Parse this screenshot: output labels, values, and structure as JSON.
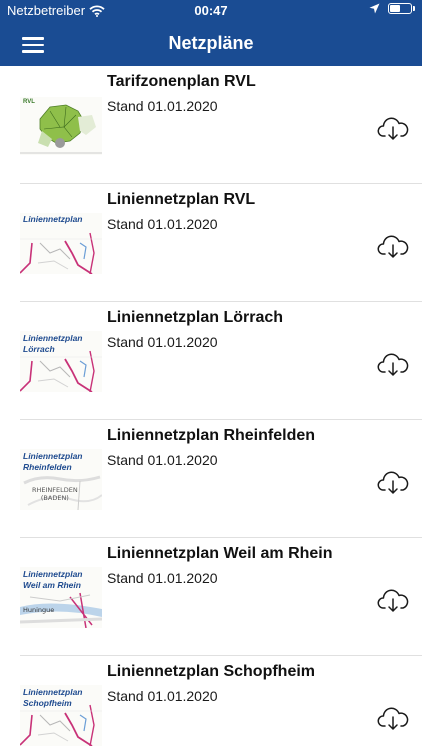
{
  "status_bar": {
    "carrier": "Netzbetreiber",
    "time": "00:47",
    "battery_level": 0.55
  },
  "nav": {
    "title": "Netzpläne",
    "menu_icon": "hamburger-menu-icon"
  },
  "theme": {
    "header_color": "#1a4c93",
    "link_color": "#1f4b8f"
  },
  "plans": [
    {
      "title": "Tarifzonenplan RVL",
      "date": "Stand 01.01.2020",
      "thumb_label": "RVL",
      "thumb_type": "tarif"
    },
    {
      "title": "Liniennetzplan RVL",
      "date": "Stand 01.01.2020",
      "thumb_label": "Liniennetzplan",
      "thumb_type": "linien"
    },
    {
      "title": "Liniennetzplan Lörrach",
      "date": "Stand 01.01.2020",
      "thumb_label": "Liniennetzplan\nLörrach",
      "thumb_type": "linien"
    },
    {
      "title": "Liniennetzplan Rheinfelden",
      "date": "Stand 01.01.2020",
      "thumb_label": "Liniennetzplan\nRheinfelden",
      "thumb_type": "rheinfelden",
      "thumb_place": "RHEINFELDEN\n(BADEN)"
    },
    {
      "title": "Liniennetzplan Weil am Rhein",
      "date": "Stand 01.01.2020",
      "thumb_label": "Liniennetzplan\nWeil am Rhein",
      "thumb_type": "weil",
      "thumb_place": "Huningue"
    },
    {
      "title": "Liniennetzplan Schopfheim",
      "date": "Stand 01.01.2020",
      "thumb_label": "Liniennetzplan\nSchopfheim",
      "thumb_type": "linien"
    }
  ]
}
